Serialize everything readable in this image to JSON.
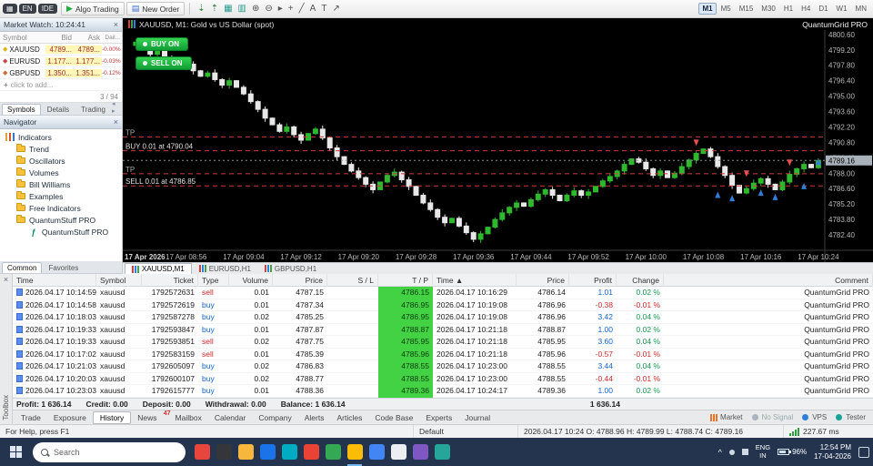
{
  "toolbar": {
    "overlay_items": [
      {
        "label": "▦",
        "n": "overlay-app-icon"
      },
      {
        "label": "EN",
        "n": "overlay-language-chip"
      },
      {
        "label": "IDE",
        "n": "overlay-ide-chip"
      }
    ],
    "algo_trading": "Algo Trading",
    "new_order": "New Order",
    "icons": [
      {
        "g": "⇣",
        "c": "#2e7d32",
        "n": "deposit-icon"
      },
      {
        "g": "⇡",
        "c": "#2e7d32",
        "n": "withdraw-icon"
      },
      {
        "g": "▦",
        "c": "#2a9d8f",
        "n": "tile-windows-icon"
      },
      {
        "g": "▥",
        "c": "#2a9d8f",
        "n": "cascade-windows-icon"
      },
      {
        "g": "⊕",
        "c": "#555555",
        "n": "zoom-in-icon"
      },
      {
        "g": "⊖",
        "c": "#555555",
        "n": "zoom-out-icon"
      },
      {
        "g": "▸",
        "c": "#555555",
        "n": "cursor-icon"
      },
      {
        "g": "+",
        "c": "#555555",
        "n": "crosshair-icon"
      },
      {
        "g": "╱",
        "c": "#555555",
        "n": "trendline-icon"
      },
      {
        "g": "A",
        "c": "#555555",
        "n": "text-tool-icon"
      },
      {
        "g": "T",
        "c": "#555555",
        "n": "label-tool-icon"
      },
      {
        "g": "↗",
        "c": "#555555",
        "n": "arrow-tool-icon"
      }
    ],
    "timeframes": [
      "M1",
      "M5",
      "M15",
      "M30",
      "H1",
      "H4",
      "D1",
      "W1",
      "MN"
    ],
    "active_timeframe": "M1"
  },
  "market_watch": {
    "title": "Market Watch: 10:24:41",
    "columns": [
      "Symbol",
      "Bid",
      "Ask",
      "Dail..."
    ],
    "rows": [
      {
        "symbol": "XAUUSD",
        "icon_color": "#e2b007",
        "bid": "4789...",
        "ask": "4789...",
        "daily": "-0.00%"
      },
      {
        "symbol": "EURUSD",
        "icon_color": "#c84444",
        "bid": "1.177...",
        "ask": "1.177...",
        "daily": "-0.03%"
      },
      {
        "symbol": "GBPUSD",
        "icon_color": "#cc6a33",
        "bid": "1.350...",
        "ask": "1.351...",
        "daily": "-0.12%"
      }
    ],
    "add_row": "click to add...",
    "counter": "3 / 94",
    "tabs": [
      "Symbols",
      "Details",
      "Trading"
    ],
    "active_tab": "Symbols",
    "tab_arrows": "◂ ▸"
  },
  "navigator": {
    "title": "Navigator",
    "root": "Indicators",
    "folders": [
      "Trend",
      "Oscillators",
      "Volumes",
      "Bill Williams",
      "Examples",
      "Free Indicators",
      "QuantumStuff PRO"
    ],
    "sub_item": "QuantumStuff PRO",
    "tabs": [
      "Common",
      "Favorites"
    ],
    "active_tab": "Common"
  },
  "chart": {
    "title": "XAUUSD, M1: Gold vs US Dollar (spot)",
    "overlay": "QuantumGrid PRO",
    "buy_button": "BUY ON",
    "sell_button": "SELL ON",
    "y_min": 4781.0,
    "y_max": 4801.0,
    "y_ticks": [
      "4800.60",
      "4799.20",
      "4797.80",
      "4796.40",
      "4795.00",
      "4793.60",
      "4792.20",
      "4790.80",
      "4789.40",
      "4788.00",
      "4786.60",
      "4785.20",
      "4783.80",
      "4782.40"
    ],
    "x_labels": [
      "17 Apr 2026",
      "17 Apr 08:56",
      "17 Apr 09:04",
      "17 Apr 09:12",
      "17 Apr 09:20",
      "17 Apr 09:28",
      "17 Apr 09:36",
      "17 Apr 09:44",
      "17 Apr 09:52",
      "17 Apr 10:00",
      "17 Apr 10:08",
      "17 Apr 10:16",
      "17 Apr 10:24"
    ],
    "closes": [
      4799.6,
      4799.9,
      4799.3,
      4798.8,
      4799.2,
      4798.5,
      4798.0,
      4797.6,
      4797.9,
      4797.3,
      4796.8,
      4797.1,
      4796.5,
      4796.0,
      4796.4,
      4795.8,
      4795.2,
      4794.5,
      4793.8,
      4793.0,
      4792.4,
      4791.8,
      4792.2,
      4791.5,
      4791.0,
      4791.6,
      4792.0,
      4791.2,
      4790.3,
      4789.5,
      4788.8,
      4788.2,
      4787.6,
      4787.0,
      4786.5,
      4787.2,
      4787.8,
      4788.1,
      4787.4,
      4786.8,
      4786.0,
      4785.3,
      4784.7,
      4784.0,
      4783.5,
      4783.9,
      4783.2,
      4782.6,
      4782.0,
      4782.5,
      4783.1,
      4783.8,
      4784.4,
      4784.9,
      4785.3,
      4785.0,
      4785.6,
      4786.1,
      4786.5,
      4786.0,
      4785.5,
      4786.0,
      4786.4,
      4786.0,
      4786.3,
      4786.8,
      4787.3,
      4787.7,
      4788.2,
      4788.8,
      4789.3,
      4789.0,
      4788.4,
      4787.8,
      4788.2,
      4787.6,
      4788.0,
      4788.6,
      4789.2,
      4789.8,
      4790.2,
      4789.5,
      4788.6,
      4787.8,
      4786.9,
      4786.2,
      4786.6,
      4787.1,
      4787.5,
      4787.0,
      4786.5,
      4787.2,
      4787.9,
      4788.4,
      4788.8,
      4788.5,
      4789.16
    ],
    "tp_lines": [
      {
        "tp_label": "TP",
        "tp_price": 4791.3,
        "order_label": "BUY 0.01 at 4790.04",
        "order_price": 4790.04
      },
      {
        "tp_label": "TP",
        "tp_price": 4787.95,
        "order_label": "SELL 0.01 at 4786.85",
        "order_price": 4786.85
      }
    ],
    "current_price": "4789.16",
    "markers": [
      {
        "i": 79,
        "p": 4790.8,
        "t": "sell"
      },
      {
        "i": 82,
        "p": 4786.0,
        "t": "buy"
      },
      {
        "i": 84,
        "p": 4785.7,
        "t": "buy"
      },
      {
        "i": 86,
        "p": 4788.0,
        "t": "sell"
      },
      {
        "i": 88,
        "p": 4786.2,
        "t": "buy"
      },
      {
        "i": 90,
        "p": 4785.8,
        "t": "buy"
      },
      {
        "i": 92,
        "p": 4789.0,
        "t": "sell"
      },
      {
        "i": 94,
        "p": 4786.8,
        "t": "buy"
      },
      {
        "i": 96,
        "p": 4789.0,
        "t": "buy"
      }
    ],
    "up_color": "#2eb82e",
    "down_color": "#e8e8e8",
    "tabs": [
      "XAUUSD,M1",
      "EURUSD,H1",
      "GBPUSD,H1"
    ],
    "active_tab": "XAUUSD,M1"
  },
  "toolbox": {
    "panel_label": "Toolbox",
    "columns": [
      "Time",
      "Symbol",
      "Ticket",
      "Type",
      "Volume",
      "Price",
      "S / L",
      "T / P",
      "Time",
      "Price",
      "Profit",
      "Change",
      "Comment"
    ],
    "sort_col": 8,
    "sort_indicator": "▲",
    "rows": [
      {
        "time": "2026.04.17 10:14:59",
        "symbol": "xauusd",
        "ticket": "1792572631",
        "type": "sell",
        "volume": "0.01",
        "price": "4787.15",
        "sl": "",
        "tp": "4786.15",
        "time2": "2026.04.17 10:16:29",
        "price2": "4786.14",
        "profit": "1.01",
        "change": "0.02 %",
        "comment": "QuantumGrid PRO"
      },
      {
        "time": "2026.04.17 10:14:58",
        "symbol": "xauusd",
        "ticket": "1792572619",
        "type": "buy",
        "volume": "0.01",
        "price": "4787.34",
        "sl": "",
        "tp": "4786.95",
        "time2": "2026.04.17 10:19:08",
        "price2": "4786.96",
        "profit": "-0.38",
        "change": "-0.01 %",
        "comment": "QuantumGrid PRO"
      },
      {
        "time": "2026.04.17 10:18:03",
        "symbol": "xauusd",
        "ticket": "1792587278",
        "type": "buy",
        "volume": "0.02",
        "price": "4785.25",
        "sl": "",
        "tp": "4786.95",
        "time2": "2026.04.17 10:19:08",
        "price2": "4786.96",
        "profit": "3.42",
        "change": "0.04 %",
        "comment": "QuantumGrid PRO"
      },
      {
        "time": "2026.04.17 10:19:33",
        "symbol": "xauusd",
        "ticket": "1792593847",
        "type": "buy",
        "volume": "0.01",
        "price": "4787.87",
        "sl": "",
        "tp": "4788.87",
        "time2": "2026.04.17 10:21:18",
        "price2": "4788.87",
        "profit": "1.00",
        "change": "0.02 %",
        "comment": "QuantumGrid PRO"
      },
      {
        "time": "2026.04.17 10:19:33",
        "symbol": "xauusd",
        "ticket": "1792593851",
        "type": "sell",
        "volume": "0.02",
        "price": "4787.75",
        "sl": "",
        "tp": "4785.95",
        "time2": "2026.04.17 10:21:18",
        "price2": "4785.95",
        "profit": "3.60",
        "change": "0.04 %",
        "comment": "QuantumGrid PRO"
      },
      {
        "time": "2026.04.17 10:17:02",
        "symbol": "xauusd",
        "ticket": "1792583159",
        "type": "sell",
        "volume": "0.01",
        "price": "4785.39",
        "sl": "",
        "tp": "4785.96",
        "time2": "2026.04.17 10:21:18",
        "price2": "4785.96",
        "profit": "-0.57",
        "change": "-0.01 %",
        "comment": "QuantumGrid PRO"
      },
      {
        "time": "2026.04.17 10:21:03",
        "symbol": "xauusd",
        "ticket": "1792605097",
        "type": "buy",
        "volume": "0.02",
        "price": "4786.83",
        "sl": "",
        "tp": "4788.55",
        "time2": "2026.04.17 10:23:00",
        "price2": "4788.55",
        "profit": "3.44",
        "change": "0.04 %",
        "comment": "QuantumGrid PRO"
      },
      {
        "time": "2026.04.17 10:20:03",
        "symbol": "xauusd",
        "ticket": "1792600107",
        "type": "buy",
        "volume": "0.02",
        "price": "4788.77",
        "sl": "",
        "tp": "4788.55",
        "time2": "2026.04.17 10:23:00",
        "price2": "4788.55",
        "profit": "-0.44",
        "change": "-0.01 %",
        "comment": "QuantumGrid PRO"
      },
      {
        "time": "2026.04.17 10:23:03",
        "symbol": "xauusd",
        "ticket": "1792615777",
        "type": "buy",
        "volume": "0.01",
        "price": "4788.36",
        "sl": "",
        "tp": "4789.36",
        "time2": "2026.04.17 10:24:17",
        "price2": "4789.36",
        "profit": "1.00",
        "change": "0.02 %",
        "comment": "QuantumGrid PRO"
      }
    ],
    "summary": {
      "items": [
        "Profit: 1 636.14",
        "Credit: 0.00",
        "Deposit: 0.00",
        "Withdrawal: 0.00",
        "Balance: 1 636.14"
      ],
      "total": "1 636.14"
    }
  },
  "bottom_tabs": {
    "items": [
      "Trade",
      "Exposure",
      "History",
      "News",
      "Mailbox",
      "Calendar",
      "Company",
      "Alerts",
      "Articles",
      "Code Base",
      "Experts",
      "Journal"
    ],
    "active": "History",
    "news_badge": "47",
    "right_items": [
      {
        "label": "Market",
        "type": "market",
        "color": "#e6762e"
      },
      {
        "label": "No Signal",
        "type": "signal",
        "color": "#aab4be"
      },
      {
        "label": "VPS",
        "type": "vps",
        "color": "#2f7ed8"
      },
      {
        "label": "Tester",
        "type": "tester",
        "color": "#18a39b"
      }
    ]
  },
  "status_bar": {
    "help": "For Help, press F1",
    "profile": "Default",
    "ohlc": "2026.04.17 10:24  O: 4788.96  H: 4789.99  L: 4788.74  C: 4789.16",
    "latency": "227.67 ms"
  },
  "taskbar": {
    "search": "Search",
    "app_colors": [
      "#e8453c",
      "#35363a",
      "#f6b73c",
      "#1a73e8",
      "#00acc1",
      "#ea4335",
      "#34a853",
      "#fbbc05",
      "#4285f4",
      "#eceff1",
      "#7e57c2",
      "#26a69a"
    ],
    "active_index": 7,
    "lang": "ENG",
    "lang_region": "IN",
    "battery": "96%",
    "time": "12:54 PM",
    "date": "17-04-2026"
  }
}
